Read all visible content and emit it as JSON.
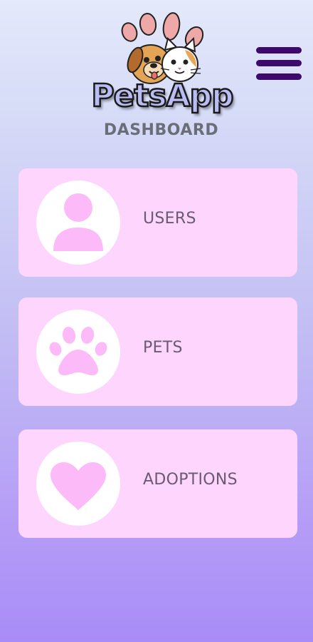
{
  "header": {
    "logo_text": "PetsApp",
    "title": "DASHBOARD"
  },
  "icons": {
    "menu": "hamburger-menu-icon",
    "users": "user-icon",
    "pets": "paw-icon",
    "adoptions": "heart-icon"
  },
  "colors": {
    "card_background": "#fdd5fd",
    "icon_fill": "#fcbaf9",
    "menu_icon": "#3d0a6b",
    "title_text": "#6b6e78",
    "label_text": "#6a5a72"
  },
  "cards": [
    {
      "label": "USERS"
    },
    {
      "label": "PETS"
    },
    {
      "label": "ADOPTIONS"
    }
  ]
}
